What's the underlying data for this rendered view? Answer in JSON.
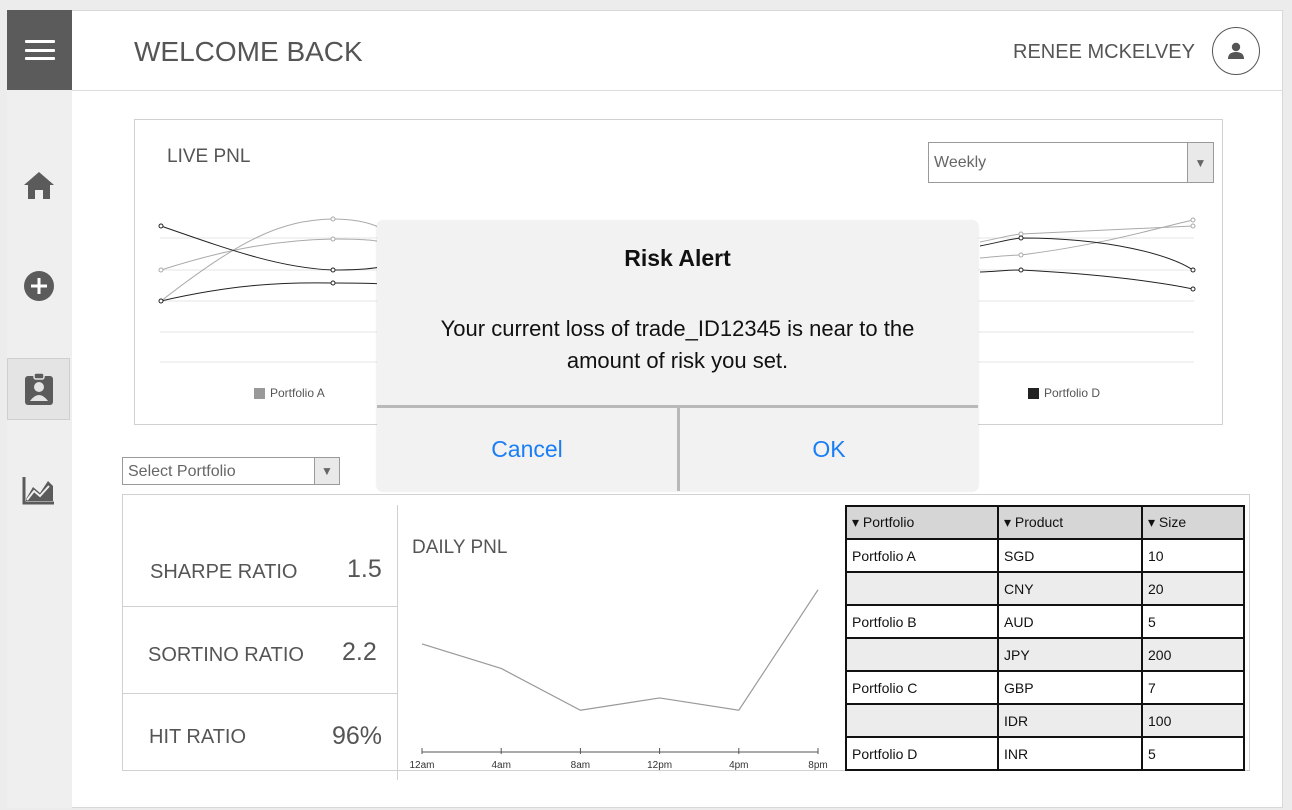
{
  "header": {
    "title": "WELCOME BACK",
    "user_name": "RENEE MCKELVEY",
    "menu_icon": "hamburger-menu-icon",
    "avatar_icon": "user-avatar-icon"
  },
  "sidebar": {
    "items": [
      {
        "name": "home",
        "icon": "home-icon",
        "active": false
      },
      {
        "name": "add",
        "icon": "add-circle-icon",
        "active": false
      },
      {
        "name": "contacts",
        "icon": "clipboard-user-icon",
        "active": true
      },
      {
        "name": "analytics",
        "icon": "area-chart-icon",
        "active": false
      }
    ]
  },
  "live_pnl": {
    "title": "LIVE PNL",
    "period_select": {
      "value": "Weekly"
    },
    "legend": [
      {
        "label": "Portfolio A",
        "color": "#999999"
      },
      {
        "label": "Portfolio D",
        "color": "#222222"
      }
    ]
  },
  "portfolio_select": {
    "value": "Select Portfolio"
  },
  "metrics": [
    {
      "label": "SHARPE RATIO",
      "value": "1.5"
    },
    {
      "label": "SORTINO RATIO",
      "value": "2.2"
    },
    {
      "label": "HIT RATIO",
      "value": "96%"
    }
  ],
  "chart_data": {
    "type": "line",
    "title": "DAILY PNL",
    "categories": [
      "12am",
      "4am",
      "8am",
      "12pm",
      "4pm",
      "8pm"
    ],
    "series": [
      {
        "values": [
          44,
          34,
          17,
          22,
          17,
          66
        ]
      }
    ],
    "ylim": [
      0,
      70
    ],
    "grid": false
  },
  "positions_table": {
    "headers": [
      "Portfolio",
      "Product",
      "Size"
    ],
    "sort_icon": "sort-down-icon",
    "rows": [
      [
        "Portfolio A",
        "SGD",
        "10"
      ],
      [
        "",
        "CNY",
        "20"
      ],
      [
        "Portfolio B",
        "AUD",
        "5"
      ],
      [
        "",
        "JPY",
        "200"
      ],
      [
        "Portfolio C",
        "GBP",
        "7"
      ],
      [
        "",
        "IDR",
        "100"
      ],
      [
        "Portfolio D",
        "INR",
        "5"
      ]
    ]
  },
  "modal": {
    "title": "Risk Alert",
    "message": "Your current loss of trade_ID12345 is near to the amount of risk you set.",
    "cancel_label": "Cancel",
    "ok_label": "OK",
    "accent_color": "#1a7ef5"
  }
}
